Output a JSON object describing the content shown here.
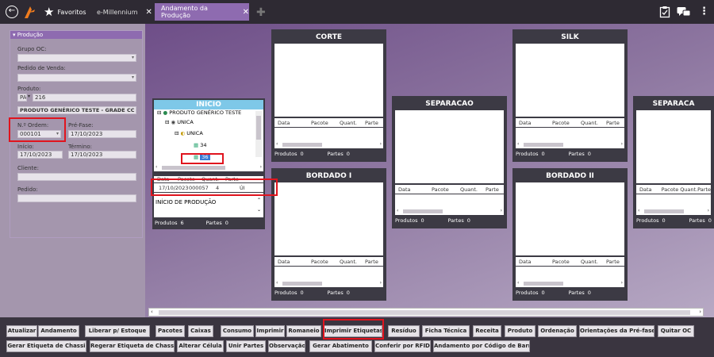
{
  "topbar": {
    "favorites_label": "Favoritos",
    "tabs": [
      {
        "label": "e-Millennium"
      },
      {
        "label": "Andamento da Produção"
      }
    ]
  },
  "filters": {
    "section_label": "Produção",
    "grupo_oc_label": "Grupo OC:",
    "pedido_venda_label": "Pedido de Venda:",
    "produto_label": "Produto:",
    "produto_code_prefix": "PA",
    "produto_code": "216",
    "produto_name": "PRODUTO GENÉRICO TESTE - GRADE CC",
    "ordem_label": "N.º Ordem:",
    "ordem_value": "000101",
    "pre_fase_label": "Pré-Fase:",
    "pre_fase_value": "17/10/2023",
    "inicio_label": "Início:",
    "inicio_value": "17/10/2023",
    "termino_label": "Término:",
    "termino_value": "17/10/2023",
    "cliente_label": "Cliente:",
    "pedido_label": "Pedido:"
  },
  "columns": {
    "data": "Data",
    "pacote": "Pacote",
    "quant": "Quant.",
    "parte": "Parte"
  },
  "inicio_card": {
    "title": "INICIO",
    "tree": [
      {
        "label": "PRODUTO GENÉRICO TESTE"
      },
      {
        "label": "UNICA"
      },
      {
        "label": "UNICA"
      },
      {
        "label": "34"
      },
      {
        "label": "36"
      }
    ],
    "row": {
      "data": "17/10/2023",
      "pacote": "000057",
      "quant": "4",
      "parte": "ÚI"
    },
    "stage_text": "INÍCIO DE PRODUÇÃO",
    "produtos_label": "Produtos",
    "produtos_count": "6",
    "partes_label": "Partes",
    "partes_count": "0"
  },
  "stage_cards": [
    {
      "title": "CORTE",
      "produtos": "0",
      "partes": "0"
    },
    {
      "title": "SEPARACAO",
      "produtos": "0",
      "partes": "0"
    },
    {
      "title": "SILK",
      "produtos": "0",
      "partes": "0"
    },
    {
      "title": "SEPARACA",
      "produtos": "0",
      "partes": "0"
    },
    {
      "title": "BORDADO I",
      "produtos": "0",
      "partes": "0"
    },
    {
      "title": "BORDADO II",
      "produtos": "0",
      "partes": "0"
    }
  ],
  "footer_labels": {
    "produtos": "Produtos",
    "partes": "Partes"
  },
  "toolbar_row1": [
    "Atualizar",
    "Andamento",
    "Liberar p/ Estoque",
    "Pacotes",
    "Caixas",
    "Consumo",
    "Imprimir",
    "Romaneio",
    "Imprimir Etiquetas",
    "Resíduo",
    "Ficha Técnica",
    "Receita",
    "Produto",
    "Ordenação",
    "Orientações da Pré-fase",
    "Quitar OC"
  ],
  "toolbar_row2": [
    "Gerar Etiqueta de Chassi",
    "Regerar Etiqueta de Chassi",
    "Alterar Célula",
    "Unir Partes",
    "Observação",
    "Gerar Abatimento",
    "Conferir por RFID",
    "Andamento por Código de Barra"
  ],
  "colors": {
    "accent": "#8e6bb0",
    "highlight": "#e0141e",
    "card_bg": "#3c3a44",
    "tree_header": "#7ec8e8"
  }
}
